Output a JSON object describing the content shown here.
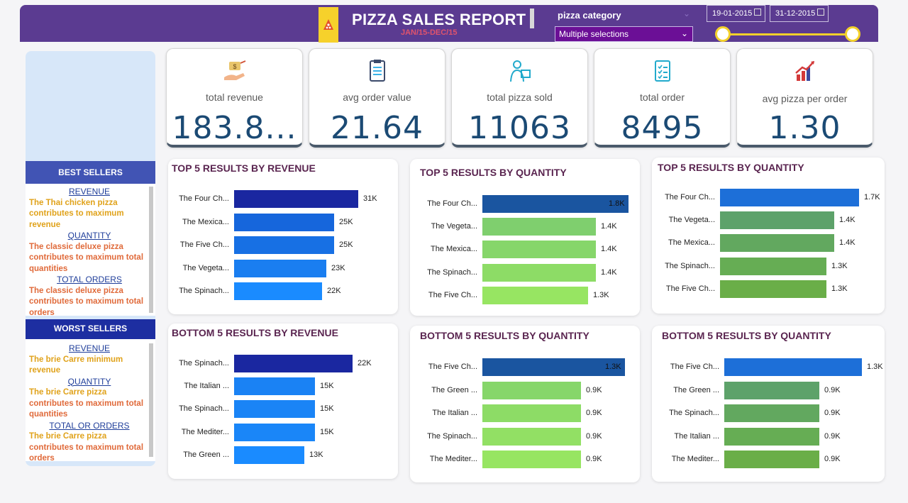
{
  "header": {
    "title": "PIZZA SALES REPORT",
    "subtitle": "JAN/15-DEC/15",
    "category_label": "pizza category",
    "category_value": "Multiple selections",
    "date_start": "19-01-2015",
    "date_end": "31-12-2015",
    "slider_range": [
      0,
      1
    ]
  },
  "best_sellers": {
    "title": "BEST SELLERS",
    "items": [
      {
        "heading": "REVENUE",
        "text": "The Thai chicken pizza contributes to maximum revenue",
        "color": "#e0a21a"
      },
      {
        "heading": "QUANTITY",
        "text": "The classic deluxe pizza contributes to maximum total quantities",
        "color": "#e06a3a"
      },
      {
        "heading": "TOTAL ORDERS",
        "text": "The classic deluxe pizza contributes to maximum total orders",
        "color": "#e06a3a"
      }
    ]
  },
  "worst_sellers": {
    "title": "WORST SELLERS",
    "items": [
      {
        "heading": "REVENUE",
        "text": "The brie Carre  minimum revenue",
        "color": "#e0a21a"
      },
      {
        "heading": "QUANTITY",
        "text_a": "The brie Carre  pizza",
        "text_b": "contributes to maximum total quantities"
      },
      {
        "heading": "TOTAL OR ORDERS",
        "text_a": "The brie Carre  pizza",
        "text_b": "contributes to maximum total orders"
      }
    ]
  },
  "kpis": [
    {
      "label": "total revenue",
      "value": "183.8...",
      "icon": "money-hand-icon"
    },
    {
      "label": "avg order value",
      "value": "21.64",
      "icon": "clipboard-icon"
    },
    {
      "label": "total pizza sold",
      "value": "11063",
      "icon": "delivery-person-icon"
    },
    {
      "label": "total order",
      "value": "8495",
      "icon": "checklist-icon"
    },
    {
      "label": "avg pizza per order",
      "value": "1.30",
      "icon": "growth-chart-icon"
    }
  ],
  "chart_data": [
    {
      "type": "bar",
      "title": "TOP 5 RESULTS BY REVENUE",
      "categories": [
        "The Four Ch...",
        "The Mexica...",
        "The Five Ch...",
        "The Vegeta...",
        "The Spinach..."
      ],
      "values": [
        31,
        25,
        25,
        23,
        22
      ],
      "labels": [
        "31K",
        "25K",
        "25K",
        "23K",
        "22K"
      ],
      "colors": [
        "#1a27a0",
        "#1666dc",
        "#1770e4",
        "#1a7ef0",
        "#1a8bff"
      ],
      "xlim": [
        0,
        31
      ]
    },
    {
      "type": "bar",
      "title": "TOP 5 RESULTS BY QUANTITY",
      "categories": [
        "The Four Ch...",
        "The Vegeta...",
        "The Mexica...",
        "The Spinach...",
        "The Five Ch..."
      ],
      "values": [
        1.8,
        1.4,
        1.4,
        1.4,
        1.3
      ],
      "labels": [
        "1.8K",
        "1.4K",
        "1.4K",
        "1.4K",
        "1.3K"
      ],
      "colors": [
        "#1a55a0",
        "#7fcf6e",
        "#86d66a",
        "#8ddc66",
        "#97e562"
      ],
      "xlim": [
        0,
        1.8
      ],
      "first_label_inside": true
    },
    {
      "type": "bar",
      "title": "TOP 5 RESULTS BY QUANTITY",
      "categories": [
        "The Four Ch...",
        "The Vegeta...",
        "The Mexica...",
        "The Spinach...",
        "The Five Ch..."
      ],
      "values": [
        1.7,
        1.4,
        1.4,
        1.3,
        1.3
      ],
      "labels": [
        "1.7K",
        "1.4K",
        "1.4K",
        "1.3K",
        "1.3K"
      ],
      "colors": [
        "#1d6fd8",
        "#5da26a",
        "#62a85f",
        "#66ad54",
        "#6aae48"
      ],
      "xlim": [
        0,
        1.7
      ]
    },
    {
      "type": "bar",
      "title": "BOTTOM 5 RESULTS BY REVENUE",
      "categories": [
        "The Spinach...",
        "The Italian ...",
        "The Spinach...",
        "The Mediter...",
        "The Green ..."
      ],
      "values": [
        22,
        15,
        15,
        15,
        13
      ],
      "labels": [
        "22K",
        "15K",
        "15K",
        "15K",
        "13K"
      ],
      "colors": [
        "#1a27a0",
        "#1a82f4",
        "#1a84f6",
        "#1a86f8",
        "#1a8bff"
      ],
      "xlim": [
        0,
        22
      ]
    },
    {
      "type": "bar",
      "title": "BOTTOM 5 RESULTS BY QUANTITY",
      "categories": [
        "The Five Ch...",
        "The Green ...",
        "The Italian ...",
        "The Spinach...",
        "The Mediter..."
      ],
      "values": [
        1.3,
        0.9,
        0.9,
        0.9,
        0.9
      ],
      "labels": [
        "1.3K",
        "0.9K",
        "0.9K",
        "0.9K",
        "0.9K"
      ],
      "colors": [
        "#1a55a0",
        "#86d66a",
        "#8ddc66",
        "#92e064",
        "#97e562"
      ],
      "xlim": [
        0,
        1.3
      ],
      "first_label_inside": true
    },
    {
      "type": "bar",
      "title": "BOTTOM 5 RESULTS BY QUANTITY",
      "categories": [
        "The Five Ch...",
        "The Green ...",
        "The Spinach...",
        "The Italian ...",
        "The Mediter..."
      ],
      "values": [
        1.3,
        0.9,
        0.9,
        0.9,
        0.9
      ],
      "labels": [
        "1.3K",
        "0.9K",
        "0.9K",
        "0.9K",
        "0.9K"
      ],
      "colors": [
        "#1d6fd8",
        "#5da26a",
        "#62a85f",
        "#66ad54",
        "#6aae48"
      ],
      "xlim": [
        0,
        1.3
      ]
    }
  ]
}
